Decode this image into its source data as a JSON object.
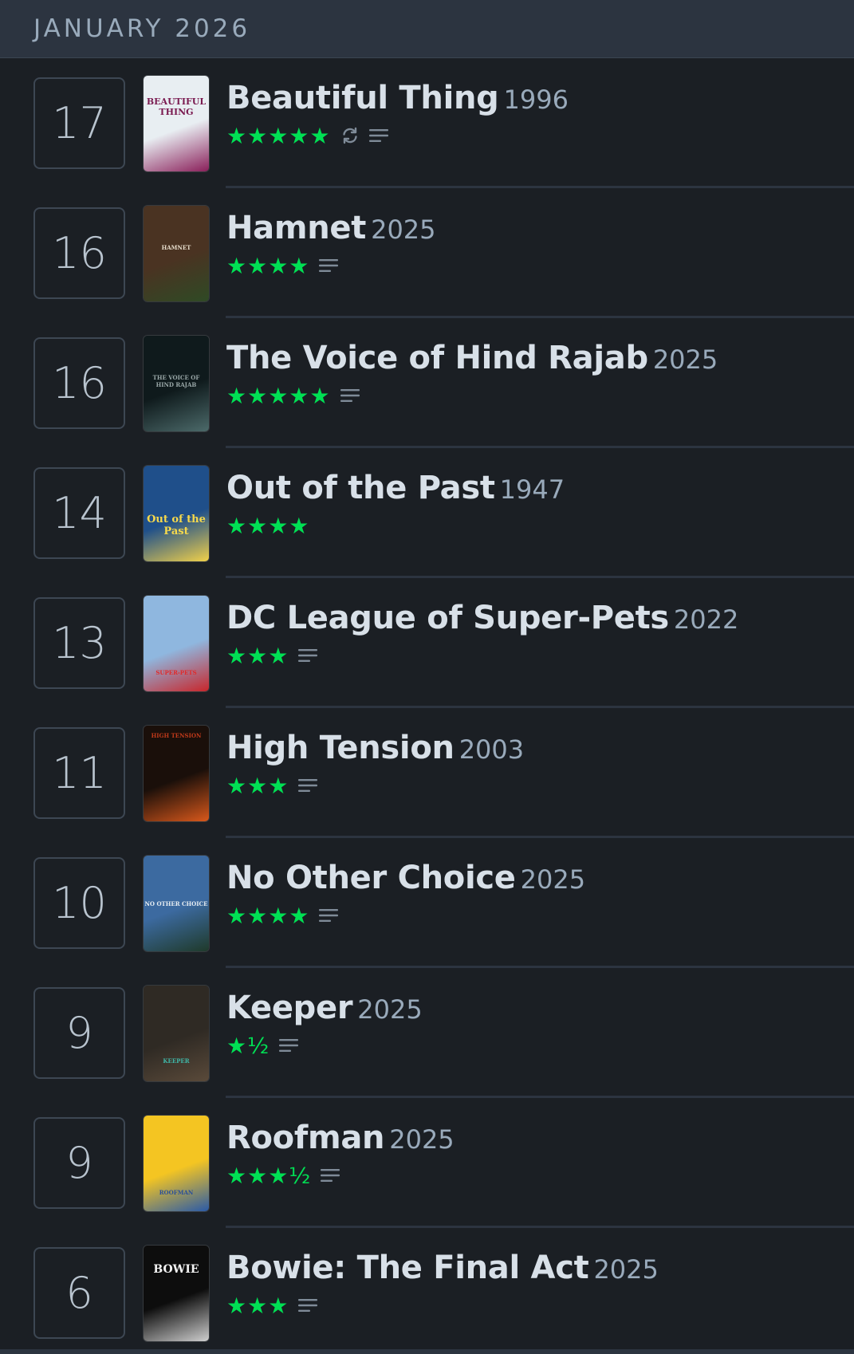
{
  "header": {
    "month": "JANUARY 2026"
  },
  "entries": [
    {
      "day": "17",
      "title": "Beautiful Thing",
      "year": "1996",
      "rating": "★★★★★",
      "rewatch": true,
      "review": true,
      "poster": {
        "bg": "#e8eef2",
        "accent": "#8a1f5a",
        "text": "BEAUTIFUL THING",
        "text_color": "#7a1a50"
      }
    },
    {
      "day": "16",
      "title": "Hamnet",
      "year": "2025",
      "rating": "★★★★",
      "rewatch": false,
      "review": true,
      "poster": {
        "bg": "#4a3322",
        "accent": "#2f4a25",
        "text": "HAMNET",
        "text_color": "#e6dccb"
      }
    },
    {
      "day": "16",
      "title": "The Voice of Hind Rajab",
      "year": "2025",
      "rating": "★★★★★",
      "rewatch": false,
      "review": true,
      "poster": {
        "bg": "#0f1a1c",
        "accent": "#4c6a6a",
        "text": "THE VOICE OF HIND RAJAB",
        "text_color": "#9aa8a8"
      }
    },
    {
      "day": "14",
      "title": "Out of the Past",
      "year": "1947",
      "rating": "★★★★",
      "rewatch": false,
      "review": false,
      "poster": {
        "bg": "#1f4f8a",
        "accent": "#f1d14a",
        "text": "Out of the Past",
        "text_color": "#f6d94c"
      }
    },
    {
      "day": "13",
      "title": "DC League of Super-Pets",
      "year": "2022",
      "rating": "★★★",
      "rewatch": false,
      "review": true,
      "poster": {
        "bg": "#8fb7df",
        "accent": "#c8262b",
        "text": "SUPER-PETS",
        "text_color": "#e22a2a"
      }
    },
    {
      "day": "11",
      "title": "High Tension",
      "year": "2003",
      "rating": "★★★",
      "rewatch": false,
      "review": true,
      "poster": {
        "bg": "#1a0f0a",
        "accent": "#d9581b",
        "text": "HIGH TENSION",
        "text_color": "#c13a1a"
      }
    },
    {
      "day": "10",
      "title": "No Other Choice",
      "year": "2025",
      "rating": "★★★★",
      "rewatch": false,
      "review": true,
      "poster": {
        "bg": "#3c6aa0",
        "accent": "#1f3a2a",
        "text": "NO OTHER CHOICE",
        "text_color": "#e8eef2"
      }
    },
    {
      "day": "9",
      "title": "Keeper",
      "year": "2025",
      "rating": "★½",
      "rewatch": false,
      "review": true,
      "poster": {
        "bg": "#2f2a24",
        "accent": "#5a4a3a",
        "text": "KEEPER",
        "text_color": "#3fb7a8"
      }
    },
    {
      "day": "9",
      "title": "Roofman",
      "year": "2025",
      "rating": "★★★½",
      "rewatch": false,
      "review": true,
      "poster": {
        "bg": "#f4c522",
        "accent": "#2a5aa8",
        "text": "ROOFMAN",
        "text_color": "#2a4f9a"
      }
    },
    {
      "day": "6",
      "title": "Bowie: The Final Act",
      "year": "2025",
      "rating": "★★★",
      "rewatch": false,
      "review": true,
      "poster": {
        "bg": "#0d0d0d",
        "accent": "#cfcfcf",
        "text": "BOWIE",
        "text_color": "#f2f2f2"
      }
    }
  ],
  "colors": {
    "page_bg": "#1b1f24",
    "header_bg": "#2c3440",
    "star_green": "#00e054",
    "title": "#d8e0e8",
    "muted": "#9ab"
  },
  "icons": {
    "rewatch": "rewatch-icon",
    "review": "review-lines-icon"
  }
}
